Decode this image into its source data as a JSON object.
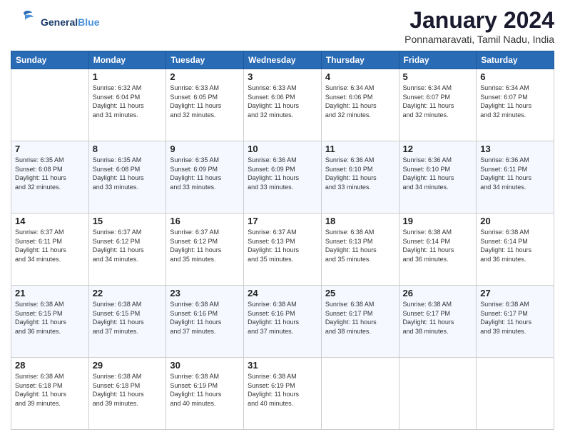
{
  "header": {
    "logo_general": "General",
    "logo_blue": "Blue",
    "title": "January 2024",
    "subtitle": "Ponnamaravati, Tamil Nadu, India"
  },
  "weekdays": [
    "Sunday",
    "Monday",
    "Tuesday",
    "Wednesday",
    "Thursday",
    "Friday",
    "Saturday"
  ],
  "weeks": [
    [
      {
        "day": "",
        "content": ""
      },
      {
        "day": "1",
        "content": "Sunrise: 6:32 AM\nSunset: 6:04 PM\nDaylight: 11 hours\nand 31 minutes."
      },
      {
        "day": "2",
        "content": "Sunrise: 6:33 AM\nSunset: 6:05 PM\nDaylight: 11 hours\nand 32 minutes."
      },
      {
        "day": "3",
        "content": "Sunrise: 6:33 AM\nSunset: 6:06 PM\nDaylight: 11 hours\nand 32 minutes."
      },
      {
        "day": "4",
        "content": "Sunrise: 6:34 AM\nSunset: 6:06 PM\nDaylight: 11 hours\nand 32 minutes."
      },
      {
        "day": "5",
        "content": "Sunrise: 6:34 AM\nSunset: 6:07 PM\nDaylight: 11 hours\nand 32 minutes."
      },
      {
        "day": "6",
        "content": "Sunrise: 6:34 AM\nSunset: 6:07 PM\nDaylight: 11 hours\nand 32 minutes."
      }
    ],
    [
      {
        "day": "7",
        "content": "Sunrise: 6:35 AM\nSunset: 6:08 PM\nDaylight: 11 hours\nand 32 minutes."
      },
      {
        "day": "8",
        "content": "Sunrise: 6:35 AM\nSunset: 6:08 PM\nDaylight: 11 hours\nand 33 minutes."
      },
      {
        "day": "9",
        "content": "Sunrise: 6:35 AM\nSunset: 6:09 PM\nDaylight: 11 hours\nand 33 minutes."
      },
      {
        "day": "10",
        "content": "Sunrise: 6:36 AM\nSunset: 6:09 PM\nDaylight: 11 hours\nand 33 minutes."
      },
      {
        "day": "11",
        "content": "Sunrise: 6:36 AM\nSunset: 6:10 PM\nDaylight: 11 hours\nand 33 minutes."
      },
      {
        "day": "12",
        "content": "Sunrise: 6:36 AM\nSunset: 6:10 PM\nDaylight: 11 hours\nand 34 minutes."
      },
      {
        "day": "13",
        "content": "Sunrise: 6:36 AM\nSunset: 6:11 PM\nDaylight: 11 hours\nand 34 minutes."
      }
    ],
    [
      {
        "day": "14",
        "content": "Sunrise: 6:37 AM\nSunset: 6:11 PM\nDaylight: 11 hours\nand 34 minutes."
      },
      {
        "day": "15",
        "content": "Sunrise: 6:37 AM\nSunset: 6:12 PM\nDaylight: 11 hours\nand 34 minutes."
      },
      {
        "day": "16",
        "content": "Sunrise: 6:37 AM\nSunset: 6:12 PM\nDaylight: 11 hours\nand 35 minutes."
      },
      {
        "day": "17",
        "content": "Sunrise: 6:37 AM\nSunset: 6:13 PM\nDaylight: 11 hours\nand 35 minutes."
      },
      {
        "day": "18",
        "content": "Sunrise: 6:38 AM\nSunset: 6:13 PM\nDaylight: 11 hours\nand 35 minutes."
      },
      {
        "day": "19",
        "content": "Sunrise: 6:38 AM\nSunset: 6:14 PM\nDaylight: 11 hours\nand 36 minutes."
      },
      {
        "day": "20",
        "content": "Sunrise: 6:38 AM\nSunset: 6:14 PM\nDaylight: 11 hours\nand 36 minutes."
      }
    ],
    [
      {
        "day": "21",
        "content": "Sunrise: 6:38 AM\nSunset: 6:15 PM\nDaylight: 11 hours\nand 36 minutes."
      },
      {
        "day": "22",
        "content": "Sunrise: 6:38 AM\nSunset: 6:15 PM\nDaylight: 11 hours\nand 37 minutes."
      },
      {
        "day": "23",
        "content": "Sunrise: 6:38 AM\nSunset: 6:16 PM\nDaylight: 11 hours\nand 37 minutes."
      },
      {
        "day": "24",
        "content": "Sunrise: 6:38 AM\nSunset: 6:16 PM\nDaylight: 11 hours\nand 37 minutes."
      },
      {
        "day": "25",
        "content": "Sunrise: 6:38 AM\nSunset: 6:17 PM\nDaylight: 11 hours\nand 38 minutes."
      },
      {
        "day": "26",
        "content": "Sunrise: 6:38 AM\nSunset: 6:17 PM\nDaylight: 11 hours\nand 38 minutes."
      },
      {
        "day": "27",
        "content": "Sunrise: 6:38 AM\nSunset: 6:17 PM\nDaylight: 11 hours\nand 39 minutes."
      }
    ],
    [
      {
        "day": "28",
        "content": "Sunrise: 6:38 AM\nSunset: 6:18 PM\nDaylight: 11 hours\nand 39 minutes."
      },
      {
        "day": "29",
        "content": "Sunrise: 6:38 AM\nSunset: 6:18 PM\nDaylight: 11 hours\nand 39 minutes."
      },
      {
        "day": "30",
        "content": "Sunrise: 6:38 AM\nSunset: 6:19 PM\nDaylight: 11 hours\nand 40 minutes."
      },
      {
        "day": "31",
        "content": "Sunrise: 6:38 AM\nSunset: 6:19 PM\nDaylight: 11 hours\nand 40 minutes."
      },
      {
        "day": "",
        "content": ""
      },
      {
        "day": "",
        "content": ""
      },
      {
        "day": "",
        "content": ""
      }
    ]
  ]
}
